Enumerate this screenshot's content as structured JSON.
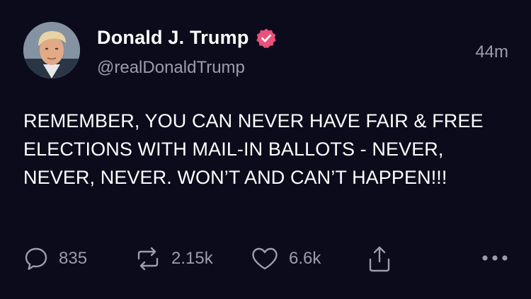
{
  "tweet": {
    "author_name": "Donald J. Trump",
    "handle": "@realDonaldTrump",
    "timestamp": "44m",
    "verified": true,
    "text": "REMEMBER, YOU CAN NEVER HAVE FAIR & FREE ELECTIONS WITH MAIL-IN BALLOTS - NEVER, NEVER, NEVER. WON’T AND CAN’T HAPPEN!!!"
  },
  "actions": {
    "replies": "835",
    "retweets": "2.15k",
    "likes": "6.6k"
  },
  "icons": {
    "reply": "speech-bubble-icon",
    "retweet": "retweet-arrows-icon",
    "like": "heart-icon",
    "share": "share-upload-icon",
    "more": "ellipsis-icon",
    "verified": "verified-badge-icon"
  },
  "colors": {
    "background": "#0c0b1c",
    "text": "#ffffff",
    "muted": "#9d9cab",
    "verified_badge": "#e9517a"
  }
}
